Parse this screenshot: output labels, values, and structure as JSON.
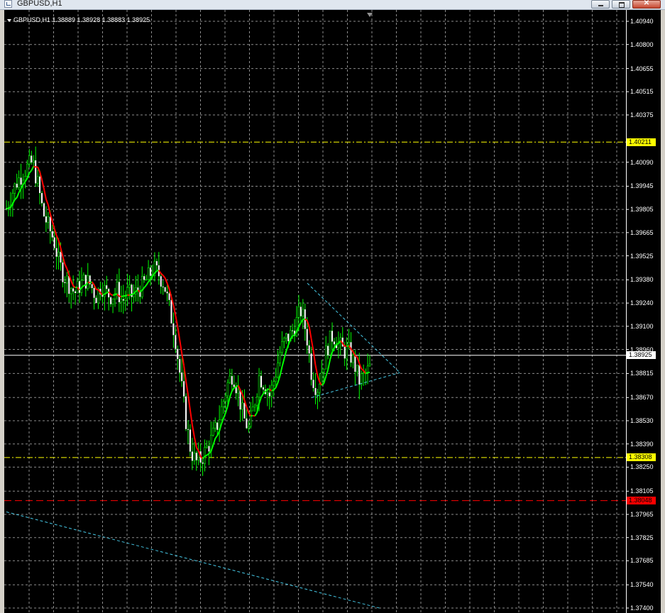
{
  "window": {
    "title": "GBPUSD,H1",
    "icon": "chart-window-icon",
    "buttons": [
      "minimize-icon",
      "maximize-icon",
      "close-icon"
    ]
  },
  "chart": {
    "symbol_label": "GBPUSD,H1  1.38889 1.38928 1.38883 1.38925",
    "background": "#000000",
    "grid_color": "#8c8c8c",
    "bull_color": "#00ff00",
    "ma_colors": [
      "#ff0000",
      "#00ff00"
    ]
  },
  "price_axis": {
    "ticks": [
      "1.40940",
      "1.40800",
      "1.40655",
      "1.40515",
      "1.40375",
      "1.40090",
      "1.39945",
      "1.39805",
      "1.39665",
      "1.39525",
      "1.39380",
      "1.39240",
      "1.39100",
      "1.38960",
      "1.38815",
      "1.38670",
      "1.38530",
      "1.38390",
      "1.38250",
      "1.38105",
      "1.37965",
      "1.37825",
      "1.37685",
      "1.37540",
      "1.37400"
    ]
  },
  "levels": [
    {
      "label": "1.40211",
      "price": 1.40211,
      "color": "#ffff00",
      "text_color": "#000000",
      "style": "dash-dot"
    },
    {
      "label": "1.38925",
      "price": 1.38925,
      "color": "#ffffff",
      "text_color": "#000000",
      "style": "solid"
    },
    {
      "label": "1.38308",
      "price": 1.38308,
      "color": "#ffff00",
      "text_color": "#000000",
      "style": "dash-dot"
    },
    {
      "label": "1.38048",
      "price": 1.38048,
      "color": "#ff0000",
      "text_color": "#000000",
      "style": "dash"
    }
  ],
  "chart_data": {
    "type": "candlestick",
    "symbol": "GBPUSD",
    "timeframe": "H1",
    "ylim": [
      1.374,
      1.4094
    ],
    "last_ohlc": {
      "open": 1.38889,
      "high": 1.38928,
      "low": 1.38883,
      "close": 1.38925
    },
    "close_path": [
      1.3981,
      1.399,
      1.3997,
      1.4002,
      1.4006,
      1.4009,
      1.3995,
      1.3978,
      1.397,
      1.3962,
      1.3948,
      1.394,
      1.3935,
      1.393,
      1.3935,
      1.3938,
      1.3935,
      1.3928,
      1.3935,
      1.393,
      1.3928,
      1.3932,
      1.3925,
      1.393,
      1.3928,
      1.3932,
      1.3935,
      1.394,
      1.3945,
      1.3941,
      1.3935,
      1.392,
      1.3905,
      1.388,
      1.3855,
      1.3835,
      1.3828,
      1.383,
      1.3836,
      1.3842,
      1.385,
      1.3862,
      1.3875,
      1.3882,
      1.387,
      1.3855,
      1.3848,
      1.3862,
      1.388,
      1.3875,
      1.3868,
      1.388,
      1.3895,
      1.3902,
      1.3905,
      1.3912,
      1.392,
      1.3905,
      1.388,
      1.3872,
      1.3885,
      1.3898,
      1.3905,
      1.39,
      1.3895,
      1.3895,
      1.3888,
      1.3877,
      1.388,
      1.3885
    ],
    "trendlines": [
      {
        "from": [
          0.484,
          1.3936
        ],
        "to": [
          0.633,
          1.3882
        ]
      },
      {
        "from": [
          0.491,
          1.3867
        ],
        "to": [
          0.633,
          1.3882
        ]
      },
      {
        "from": [
          0.0,
          1.3798
        ],
        "to": [
          0.6,
          1.374
        ]
      }
    ]
  }
}
